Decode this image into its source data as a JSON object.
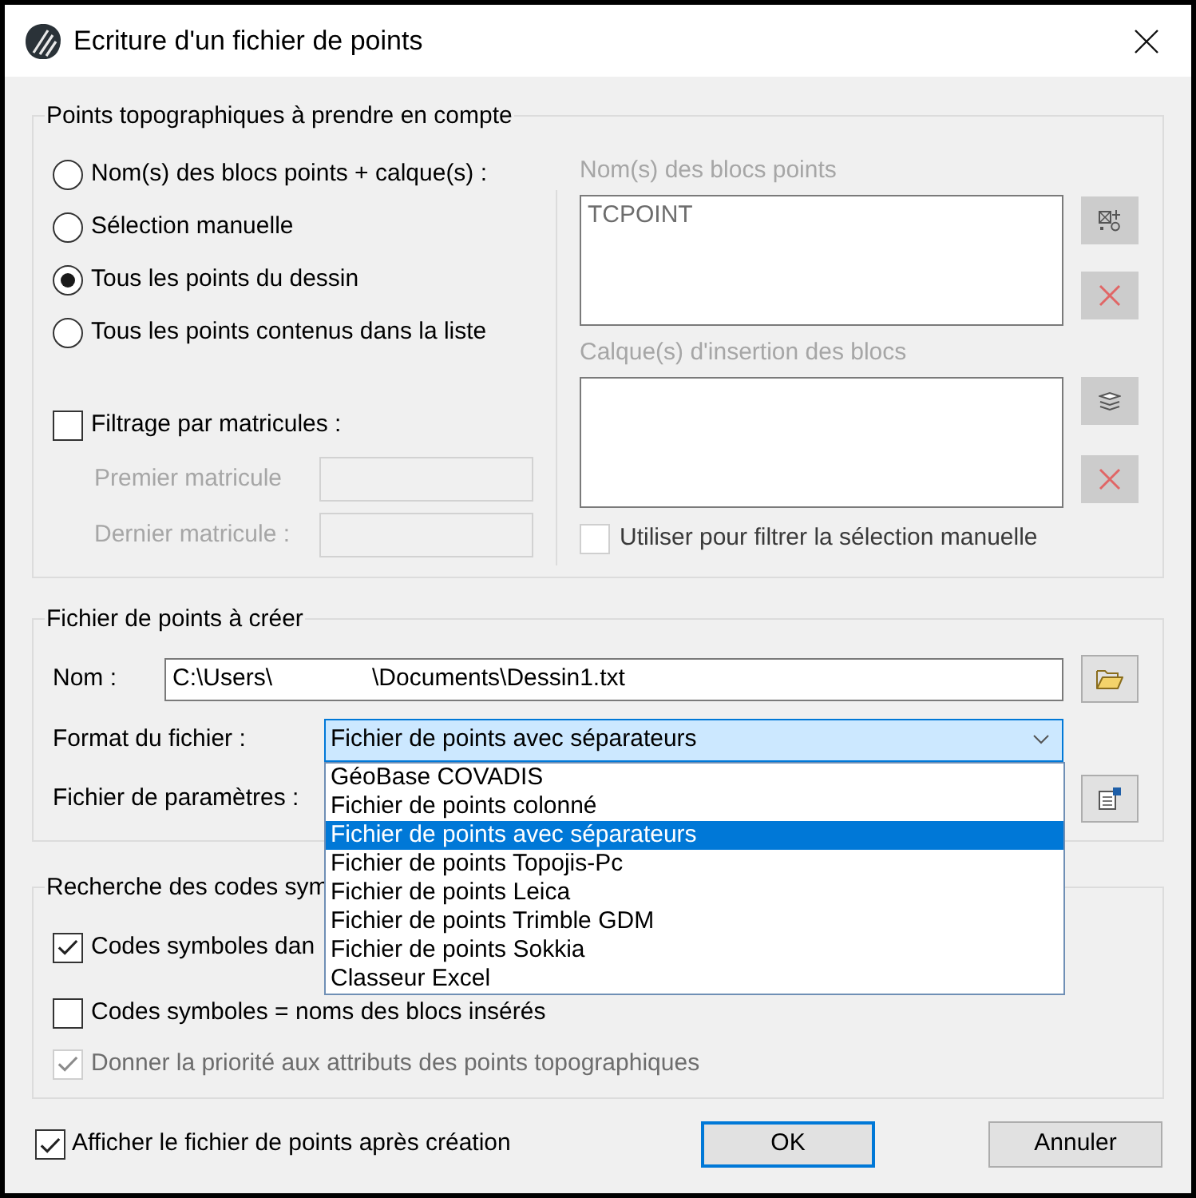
{
  "window": {
    "title": "Ecriture d'un fichier de points"
  },
  "points_group": {
    "title": "Points topographiques à prendre en compte",
    "options": [
      {
        "label": "Nom(s) des blocs points + calque(s) :",
        "selected": false
      },
      {
        "label": "Sélection manuelle",
        "selected": false
      },
      {
        "label": "Tous les points du dessin",
        "selected": true
      },
      {
        "label": "Tous les points contenus dans la liste",
        "selected": false
      }
    ],
    "filter": {
      "label": "Filtrage par matricules :",
      "checked": false
    },
    "fields": [
      {
        "label": "Premier matricule",
        "disabled": true
      },
      {
        "label": "Dernier matricule :",
        "disabled": true
      }
    ],
    "blocks": {
      "label": "Nom(s) des blocs points",
      "disabled": true,
      "items": [
        "TCPOINT"
      ]
    },
    "layers": {
      "label": "Calque(s) d'insertion des blocs",
      "disabled": true
    },
    "use_for_filter": {
      "label": "Utiliser pour filtrer la sélection manuelle",
      "checked": false,
      "disabled": true
    }
  },
  "file_group": {
    "title": "Fichier de points à créer",
    "name": {
      "label": "Nom :",
      "value": "C:\\Users\\               \\Documents\\Dessin1.txt"
    },
    "format": {
      "label": "Format du fichier :",
      "value": "Fichier de points avec séparateurs",
      "expanded": true,
      "options": [
        {
          "label": "GéoBase COVADIS",
          "selected": false
        },
        {
          "label": "Fichier de points colonné",
          "selected": false
        },
        {
          "label": "Fichier de points avec séparateurs",
          "selected": true
        },
        {
          "label": "Fichier de points Topojis-Pc",
          "selected": false
        },
        {
          "label": "Fichier de points Leica",
          "selected": false
        },
        {
          "label": "Fichier de points Trimble GDM",
          "selected": false
        },
        {
          "label": "Fichier de points Sokkia",
          "selected": false
        },
        {
          "label": "Classeur Excel",
          "selected": false
        }
      ]
    },
    "parameters": {
      "label": "Fichier de paramètres :"
    }
  },
  "codes_group": {
    "title": "Recherche des codes sym",
    "options": [
      {
        "label": "Codes symboles dan",
        "checked": true,
        "disabled": false
      },
      {
        "label": "Codes symboles = noms des blocs insérés",
        "checked": false,
        "disabled": false
      },
      {
        "label": "Donner la priorité aux attributs des points topographiques",
        "checked": true,
        "disabled": true
      }
    ]
  },
  "show_after": {
    "label": "Afficher le fichier de points après création",
    "checked": true
  },
  "buttons": [
    {
      "label": "OK",
      "default": true
    },
    {
      "label": "Annuler",
      "default": false
    }
  ]
}
